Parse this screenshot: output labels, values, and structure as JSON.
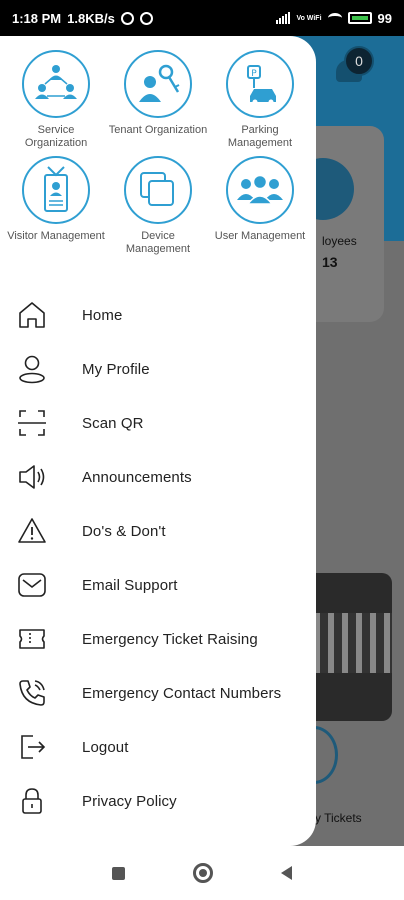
{
  "status_bar": {
    "time": "1:18 PM",
    "speed": "1.8KB/s",
    "network": "Vo WiFi",
    "battery": "99"
  },
  "background": {
    "notification_count": "0",
    "card_label": "loyees",
    "card_value": "13",
    "tickets_label": "y Tickets"
  },
  "drawer": {
    "tiles": [
      {
        "label": "Service Organization",
        "icon": "people-network-icon"
      },
      {
        "label": "Tenant Organization",
        "icon": "person-key-icon"
      },
      {
        "label": "Parking Management",
        "icon": "car-parking-icon"
      },
      {
        "label": "Visitor Management",
        "icon": "id-badge-icon"
      },
      {
        "label": "Device Management",
        "icon": "devices-icon"
      },
      {
        "label": "User Management",
        "icon": "user-group-icon"
      }
    ],
    "menu": [
      {
        "label": "Home",
        "icon": "home-icon"
      },
      {
        "label": "My Profile",
        "icon": "profile-icon"
      },
      {
        "label": "Scan QR",
        "icon": "scan-qr-icon"
      },
      {
        "label": "Announcements",
        "icon": "speaker-icon"
      },
      {
        "label": "Do's & Don't",
        "icon": "warning-icon"
      },
      {
        "label": "Email Support",
        "icon": "mail-icon"
      },
      {
        "label": "Emergency Ticket Raising",
        "icon": "ticket-icon"
      },
      {
        "label": "Emergency Contact Numbers",
        "icon": "phone-icon"
      },
      {
        "label": "Logout",
        "icon": "logout-icon"
      },
      {
        "label": "Privacy Policy",
        "icon": "lock-icon"
      }
    ]
  },
  "colors": {
    "accent": "#2f9fd2",
    "icon_stroke": "#222222"
  }
}
